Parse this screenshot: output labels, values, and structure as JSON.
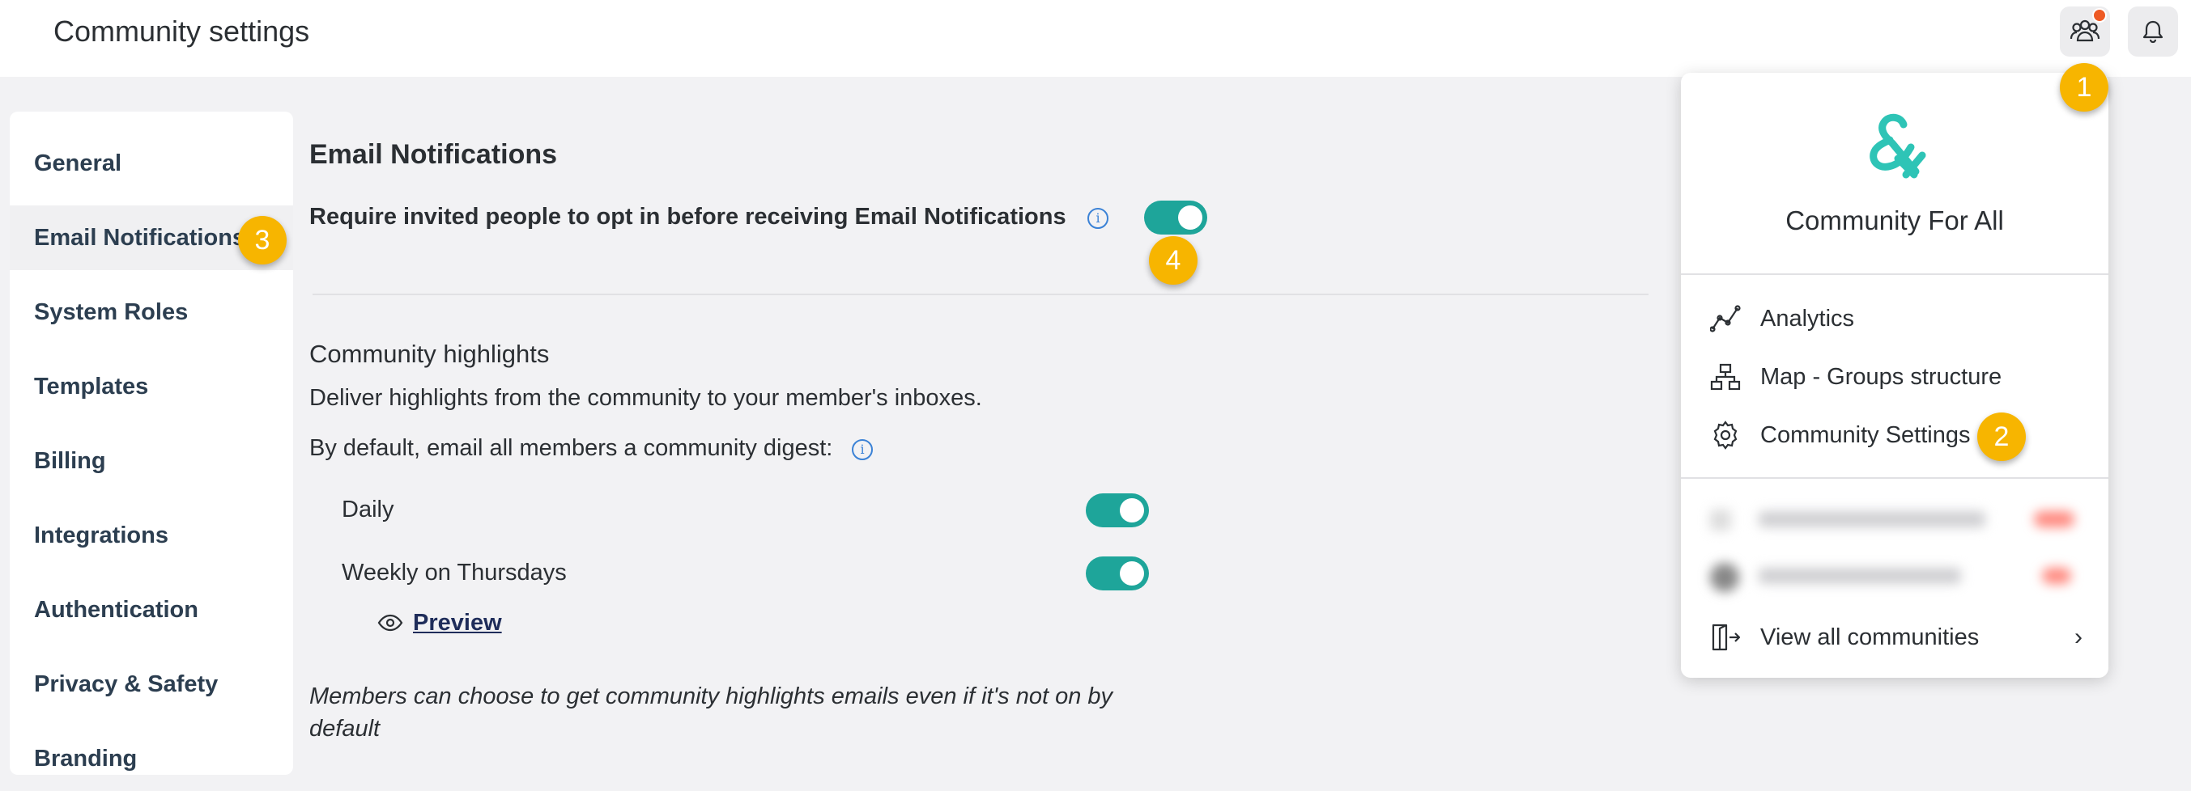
{
  "header": {
    "title": "Community settings",
    "members_icon": "members-icon",
    "bell_icon": "bell-icon"
  },
  "badges": [
    "1",
    "2",
    "3",
    "4"
  ],
  "sidebar": {
    "items": [
      {
        "label": "General"
      },
      {
        "label": "Email Notifications"
      },
      {
        "label": "System Roles"
      },
      {
        "label": "Templates"
      },
      {
        "label": "Billing"
      },
      {
        "label": "Integrations"
      },
      {
        "label": "Authentication"
      },
      {
        "label": "Privacy & Safety"
      },
      {
        "label": "Branding"
      }
    ]
  },
  "main": {
    "section_title": "Email Notifications",
    "opt_in_label": "Require invited people to opt in before receiving Email Notifications",
    "opt_in_enabled": true,
    "highlights_title": "Community highlights",
    "highlights_desc": "Deliver highlights from the community to your member's inboxes.",
    "digest_default_label": "By default, email all members a community digest:",
    "daily_label": "Daily",
    "daily_enabled": true,
    "weekly_label": "Weekly on Thursdays",
    "weekly_enabled": true,
    "preview_label": "Preview",
    "note_line1": "Members can choose to get community highlights emails even if it's not on by",
    "note_line2": "default"
  },
  "dropdown": {
    "community_name": "Community For All",
    "items": [
      {
        "label": "Analytics",
        "icon": "analytics-icon"
      },
      {
        "label": "Map - Groups structure",
        "icon": "sitemap-icon"
      },
      {
        "label": "Community Settings",
        "icon": "gear-icon"
      }
    ],
    "view_all_label": "View all communities"
  },
  "colors": {
    "accent": "#1ea59a",
    "badge": "#f7b500",
    "notification_dot": "#ee5a24",
    "link": "#1f2d5a"
  }
}
